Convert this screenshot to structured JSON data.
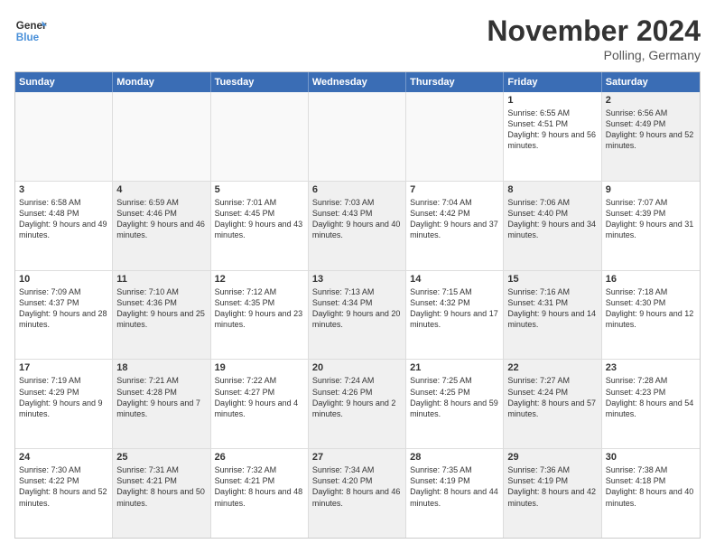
{
  "header": {
    "logo_line1": "General",
    "logo_line2": "Blue",
    "month": "November 2024",
    "location": "Polling, Germany"
  },
  "days_of_week": [
    "Sunday",
    "Monday",
    "Tuesday",
    "Wednesday",
    "Thursday",
    "Friday",
    "Saturday"
  ],
  "rows": [
    [
      {
        "date": "",
        "text": "",
        "shaded": false,
        "empty": true
      },
      {
        "date": "",
        "text": "",
        "shaded": false,
        "empty": true
      },
      {
        "date": "",
        "text": "",
        "shaded": false,
        "empty": true
      },
      {
        "date": "",
        "text": "",
        "shaded": false,
        "empty": true
      },
      {
        "date": "",
        "text": "",
        "shaded": false,
        "empty": true
      },
      {
        "date": "1",
        "text": "Sunrise: 6:55 AM\nSunset: 4:51 PM\nDaylight: 9 hours and 56 minutes.",
        "shaded": false,
        "empty": false
      },
      {
        "date": "2",
        "text": "Sunrise: 6:56 AM\nSunset: 4:49 PM\nDaylight: 9 hours and 52 minutes.",
        "shaded": true,
        "empty": false
      }
    ],
    [
      {
        "date": "3",
        "text": "Sunrise: 6:58 AM\nSunset: 4:48 PM\nDaylight: 9 hours and 49 minutes.",
        "shaded": false,
        "empty": false
      },
      {
        "date": "4",
        "text": "Sunrise: 6:59 AM\nSunset: 4:46 PM\nDaylight: 9 hours and 46 minutes.",
        "shaded": true,
        "empty": false
      },
      {
        "date": "5",
        "text": "Sunrise: 7:01 AM\nSunset: 4:45 PM\nDaylight: 9 hours and 43 minutes.",
        "shaded": false,
        "empty": false
      },
      {
        "date": "6",
        "text": "Sunrise: 7:03 AM\nSunset: 4:43 PM\nDaylight: 9 hours and 40 minutes.",
        "shaded": true,
        "empty": false
      },
      {
        "date": "7",
        "text": "Sunrise: 7:04 AM\nSunset: 4:42 PM\nDaylight: 9 hours and 37 minutes.",
        "shaded": false,
        "empty": false
      },
      {
        "date": "8",
        "text": "Sunrise: 7:06 AM\nSunset: 4:40 PM\nDaylight: 9 hours and 34 minutes.",
        "shaded": true,
        "empty": false
      },
      {
        "date": "9",
        "text": "Sunrise: 7:07 AM\nSunset: 4:39 PM\nDaylight: 9 hours and 31 minutes.",
        "shaded": false,
        "empty": false
      }
    ],
    [
      {
        "date": "10",
        "text": "Sunrise: 7:09 AM\nSunset: 4:37 PM\nDaylight: 9 hours and 28 minutes.",
        "shaded": false,
        "empty": false
      },
      {
        "date": "11",
        "text": "Sunrise: 7:10 AM\nSunset: 4:36 PM\nDaylight: 9 hours and 25 minutes.",
        "shaded": true,
        "empty": false
      },
      {
        "date": "12",
        "text": "Sunrise: 7:12 AM\nSunset: 4:35 PM\nDaylight: 9 hours and 23 minutes.",
        "shaded": false,
        "empty": false
      },
      {
        "date": "13",
        "text": "Sunrise: 7:13 AM\nSunset: 4:34 PM\nDaylight: 9 hours and 20 minutes.",
        "shaded": true,
        "empty": false
      },
      {
        "date": "14",
        "text": "Sunrise: 7:15 AM\nSunset: 4:32 PM\nDaylight: 9 hours and 17 minutes.",
        "shaded": false,
        "empty": false
      },
      {
        "date": "15",
        "text": "Sunrise: 7:16 AM\nSunset: 4:31 PM\nDaylight: 9 hours and 14 minutes.",
        "shaded": true,
        "empty": false
      },
      {
        "date": "16",
        "text": "Sunrise: 7:18 AM\nSunset: 4:30 PM\nDaylight: 9 hours and 12 minutes.",
        "shaded": false,
        "empty": false
      }
    ],
    [
      {
        "date": "17",
        "text": "Sunrise: 7:19 AM\nSunset: 4:29 PM\nDaylight: 9 hours and 9 minutes.",
        "shaded": false,
        "empty": false
      },
      {
        "date": "18",
        "text": "Sunrise: 7:21 AM\nSunset: 4:28 PM\nDaylight: 9 hours and 7 minutes.",
        "shaded": true,
        "empty": false
      },
      {
        "date": "19",
        "text": "Sunrise: 7:22 AM\nSunset: 4:27 PM\nDaylight: 9 hours and 4 minutes.",
        "shaded": false,
        "empty": false
      },
      {
        "date": "20",
        "text": "Sunrise: 7:24 AM\nSunset: 4:26 PM\nDaylight: 9 hours and 2 minutes.",
        "shaded": true,
        "empty": false
      },
      {
        "date": "21",
        "text": "Sunrise: 7:25 AM\nSunset: 4:25 PM\nDaylight: 8 hours and 59 minutes.",
        "shaded": false,
        "empty": false
      },
      {
        "date": "22",
        "text": "Sunrise: 7:27 AM\nSunset: 4:24 PM\nDaylight: 8 hours and 57 minutes.",
        "shaded": true,
        "empty": false
      },
      {
        "date": "23",
        "text": "Sunrise: 7:28 AM\nSunset: 4:23 PM\nDaylight: 8 hours and 54 minutes.",
        "shaded": false,
        "empty": false
      }
    ],
    [
      {
        "date": "24",
        "text": "Sunrise: 7:30 AM\nSunset: 4:22 PM\nDaylight: 8 hours and 52 minutes.",
        "shaded": false,
        "empty": false
      },
      {
        "date": "25",
        "text": "Sunrise: 7:31 AM\nSunset: 4:21 PM\nDaylight: 8 hours and 50 minutes.",
        "shaded": true,
        "empty": false
      },
      {
        "date": "26",
        "text": "Sunrise: 7:32 AM\nSunset: 4:21 PM\nDaylight: 8 hours and 48 minutes.",
        "shaded": false,
        "empty": false
      },
      {
        "date": "27",
        "text": "Sunrise: 7:34 AM\nSunset: 4:20 PM\nDaylight: 8 hours and 46 minutes.",
        "shaded": true,
        "empty": false
      },
      {
        "date": "28",
        "text": "Sunrise: 7:35 AM\nSunset: 4:19 PM\nDaylight: 8 hours and 44 minutes.",
        "shaded": false,
        "empty": false
      },
      {
        "date": "29",
        "text": "Sunrise: 7:36 AM\nSunset: 4:19 PM\nDaylight: 8 hours and 42 minutes.",
        "shaded": true,
        "empty": false
      },
      {
        "date": "30",
        "text": "Sunrise: 7:38 AM\nSunset: 4:18 PM\nDaylight: 8 hours and 40 minutes.",
        "shaded": false,
        "empty": false
      }
    ]
  ]
}
